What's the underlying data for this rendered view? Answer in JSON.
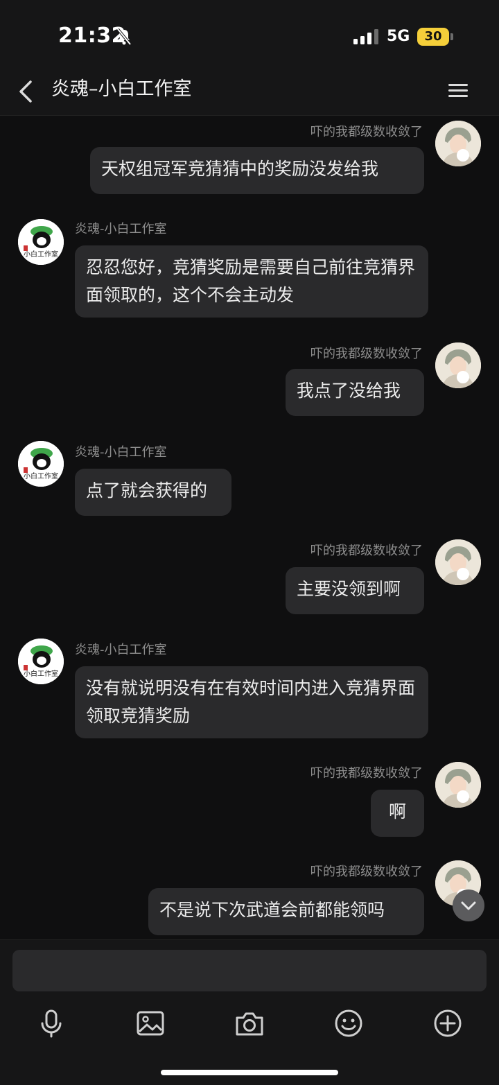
{
  "status_bar": {
    "time": "21:32",
    "network": "5G",
    "battery": "30"
  },
  "header": {
    "title": "炎魂–小白工作室"
  },
  "messages": [
    {
      "sender": "吓的我都级数收敛了",
      "text": "天权组冠军竞猜猜中的奖励没发给我"
    },
    {
      "sender": "炎魂-小白工作室",
      "text": "忍忍您好，竞猜奖励是需要自己前往竞猜界面领取的，这个不会主动发"
    },
    {
      "sender": "吓的我都级数收敛了",
      "text": "我点了没给我"
    },
    {
      "sender": "炎魂-小白工作室",
      "text": "点了就会获得的"
    },
    {
      "sender": "吓的我都级数收敛了",
      "text": "主要没领到啊"
    },
    {
      "sender": "炎魂-小白工作室",
      "text": "没有就说明没有在有效时间内进入竞猜界面领取竞猜奖励"
    },
    {
      "sender": "吓的我都级数收敛了",
      "text": "啊"
    },
    {
      "sender": "吓的我都级数收敛了",
      "text": "不是说下次武道会前都能领吗"
    }
  ],
  "studio_avatar_text": "小白工作室",
  "composer": {
    "placeholder": ""
  },
  "icons": [
    "back-icon",
    "menu-icon",
    "microphone-icon",
    "image-icon",
    "camera-icon",
    "emoji-icon",
    "plus-icon",
    "chevron-down-icon"
  ],
  "colors": {
    "background": "#0f0f10",
    "bubble": "#2a2a2c",
    "battery": "#f5cf3a"
  }
}
